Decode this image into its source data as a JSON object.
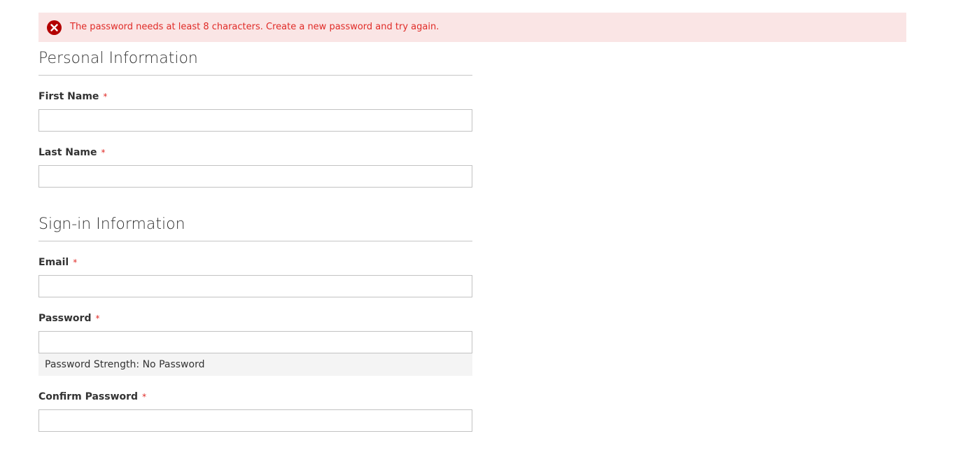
{
  "error": {
    "message": "The password needs at least 8 characters. Create a new password and try again.",
    "icon": "error-circle-x-icon",
    "color": "#e02b27",
    "background": "#fae5e5"
  },
  "personal": {
    "legend": "Personal Information",
    "first_name_label": "First Name",
    "last_name_label": "Last Name",
    "first_name_value": "",
    "last_name_value": ""
  },
  "signin": {
    "legend": "Sign-in Information",
    "email_label": "Email",
    "password_label": "Password",
    "password_strength_label": "Password Strength:",
    "password_strength_value": "No Password",
    "confirm_password_label": "Confirm Password",
    "email_value": "",
    "password_value": "",
    "confirm_password_value": ""
  },
  "required_mark": "*",
  "colors": {
    "required": "#e02b27",
    "text": "#333333",
    "input_border": "#c2c2c2",
    "strength_background": "#f4f4f4"
  }
}
